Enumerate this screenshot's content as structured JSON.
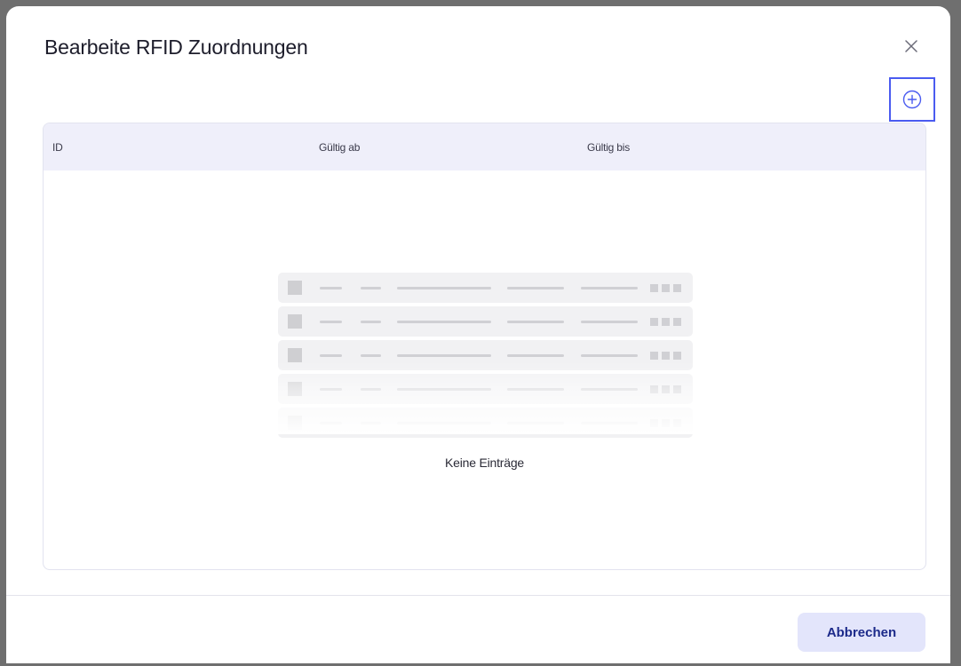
{
  "dialog": {
    "title": "Bearbeite RFID Zuordnungen"
  },
  "icons": {
    "close": "close-icon",
    "add": "plus-circle-icon"
  },
  "colors": {
    "accent": "#4a5bf0",
    "header_bg": "#efeffa",
    "button_bg": "#e3e5fb",
    "button_text": "#1c2a8a"
  },
  "table": {
    "columns": [
      "ID",
      "Gültig ab",
      "Gültig bis"
    ],
    "empty_message": "Keine Einträge"
  },
  "footer": {
    "cancel_label": "Abbrechen"
  }
}
